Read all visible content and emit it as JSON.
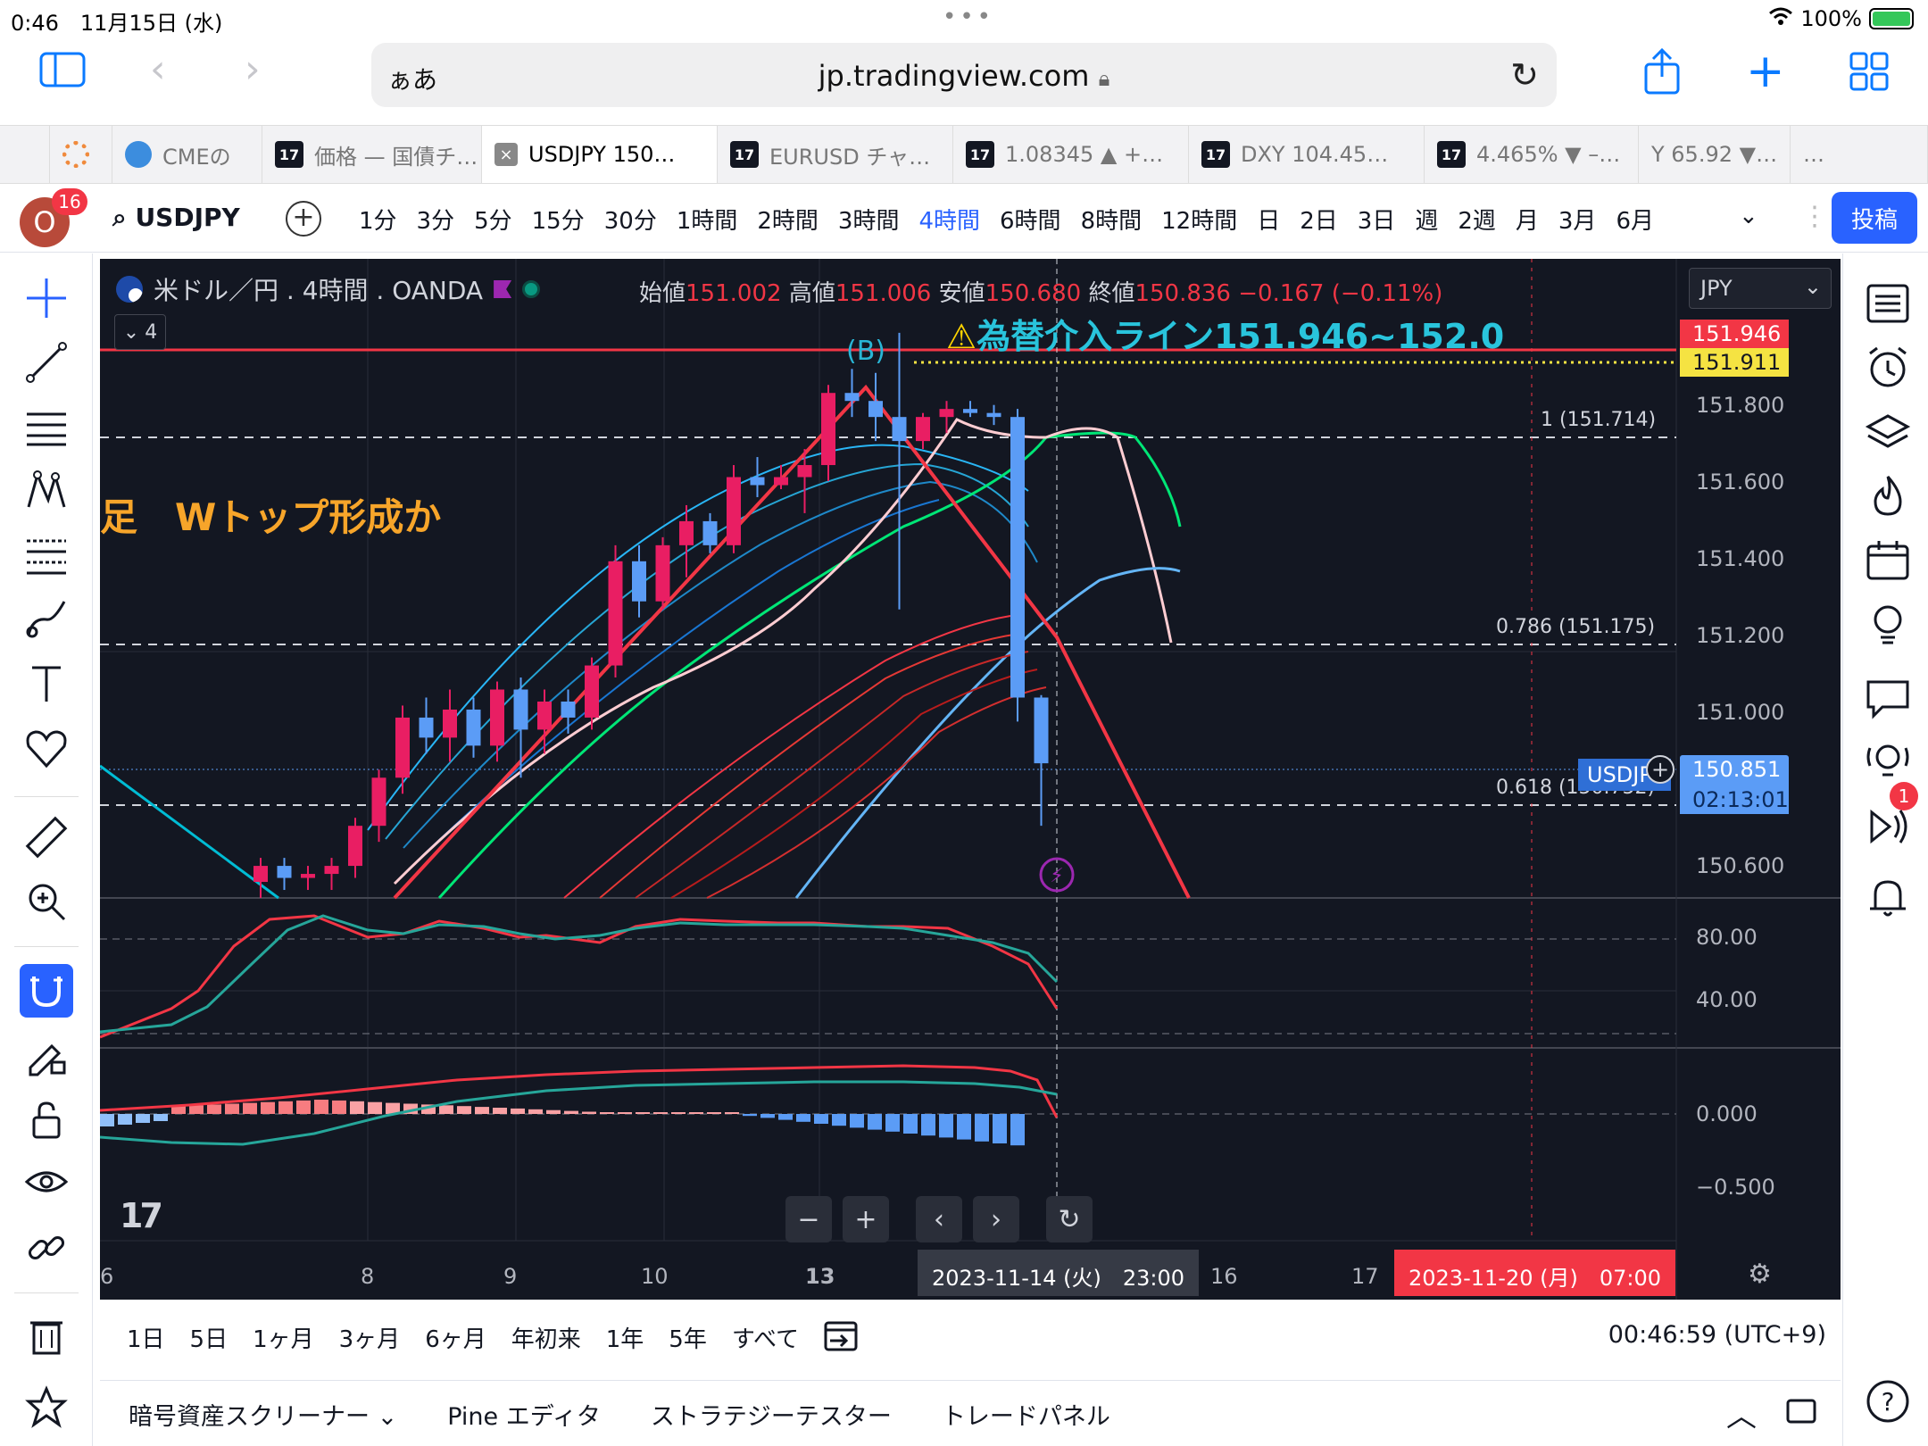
{
  "status_bar": {
    "time": "0:46",
    "date": "11月15日 (水)",
    "battery": "100%"
  },
  "safari": {
    "aa": "ぁあ",
    "url": "jp.tradingview.com"
  },
  "tabs": [
    {
      "label": "CMEの",
      "icon": "cme-icon"
    },
    {
      "label": "価格 — 国債チ…",
      "icon": "tv-icon"
    },
    {
      "label": "USDJPY 150…",
      "icon": "close-icon",
      "active": true
    },
    {
      "label": "EURUSD チャ…",
      "icon": "tv-icon"
    },
    {
      "label": "1.08345 ▲ +…",
      "icon": "tv-icon"
    },
    {
      "label": "DXY 104.45…",
      "icon": "tv-icon"
    },
    {
      "label": "4.465% ▼ –…",
      "icon": "tv-icon"
    },
    {
      "label": "Y 65.92 ▼…",
      "icon": ""
    },
    {
      "label": "…",
      "icon": ""
    }
  ],
  "toolbar": {
    "notification_count": "16",
    "symbol": "USDJPY",
    "intervals": [
      "1分",
      "3分",
      "5分",
      "15分",
      "30分",
      "1時間",
      "2時間",
      "3時間",
      "4時間",
      "6時間",
      "8時間",
      "12時間",
      "日",
      "2日",
      "3日",
      "週",
      "2週",
      "月",
      "3月",
      "6月"
    ],
    "active_interval": "4時間",
    "publish": "投稿"
  },
  "chart": {
    "title": "米ドル／円 . 4時間 . OANDA",
    "indicator_count": "4",
    "currency": "JPY",
    "ohlc": {
      "open_label": "始値",
      "open": "151.002",
      "high_label": "高値",
      "high": "151.006",
      "low_label": "安値",
      "low": "150.680",
      "close_label": "終値",
      "close": "150.836",
      "change": "−0.167 (−0.11%)"
    },
    "annotation_warning": "為替介入ライン151.946~152.0",
    "annotation_pattern": "足　Wトップ形成か",
    "annotation_b": "(B)",
    "fib_labels": {
      "f1": "1 (151.714)",
      "f786": "0.786 (151.175)",
      "f618": "0.618 (150.752)"
    },
    "price_labels": [
      "151.800",
      "151.600",
      "151.400",
      "151.200",
      "151.000",
      "150.600"
    ],
    "price_badge_red": "151.946",
    "price_badge_yellow": "151.911",
    "last_price": "150.851",
    "countdown": "02:13:01",
    "series_tag": "USDJPY",
    "osc_labels": [
      "80.00",
      "40.00"
    ],
    "macd_labels": [
      "0.000",
      "−0.500"
    ],
    "x_labels": [
      "6",
      "8",
      "9",
      "10",
      "13",
      "16",
      "17"
    ],
    "cursor_time": "2023-11-14 (火)　23:00",
    "future_time": "2023-11-20 (月)　07:00",
    "colors": {
      "up": "#e91e63",
      "down": "#5b9cf6",
      "line": "#f23645",
      "bg": "#131722"
    }
  },
  "chart_data": {
    "type": "candlestick",
    "symbol": "USDJPY 4H OANDA",
    "candles": [
      {
        "o": 150.54,
        "h": 150.6,
        "l": 150.5,
        "c": 150.58
      },
      {
        "o": 150.58,
        "h": 150.6,
        "l": 150.52,
        "c": 150.55
      },
      {
        "o": 150.55,
        "h": 150.58,
        "l": 150.52,
        "c": 150.56
      },
      {
        "o": 150.56,
        "h": 150.6,
        "l": 150.52,
        "c": 150.58
      },
      {
        "o": 150.58,
        "h": 150.7,
        "l": 150.55,
        "c": 150.68
      },
      {
        "o": 150.68,
        "h": 150.82,
        "l": 150.64,
        "c": 150.8
      },
      {
        "o": 150.8,
        "h": 150.98,
        "l": 150.76,
        "c": 150.95
      },
      {
        "o": 150.95,
        "h": 151.0,
        "l": 150.86,
        "c": 150.9
      },
      {
        "o": 150.9,
        "h": 151.02,
        "l": 150.84,
        "c": 150.97
      },
      {
        "o": 150.97,
        "h": 151.0,
        "l": 150.85,
        "c": 150.88
      },
      {
        "o": 150.88,
        "h": 151.04,
        "l": 150.84,
        "c": 151.02
      },
      {
        "o": 151.02,
        "h": 151.05,
        "l": 150.8,
        "c": 150.92
      },
      {
        "o": 150.92,
        "h": 151.02,
        "l": 150.86,
        "c": 150.99
      },
      {
        "o": 150.99,
        "h": 151.02,
        "l": 150.91,
        "c": 150.95
      },
      {
        "o": 150.95,
        "h": 151.1,
        "l": 150.92,
        "c": 151.08
      },
      {
        "o": 151.08,
        "h": 151.38,
        "l": 151.05,
        "c": 151.34
      },
      {
        "o": 151.34,
        "h": 151.38,
        "l": 151.2,
        "c": 151.24
      },
      {
        "o": 151.24,
        "h": 151.4,
        "l": 151.22,
        "c": 151.38
      },
      {
        "o": 151.38,
        "h": 151.48,
        "l": 151.3,
        "c": 151.44
      },
      {
        "o": 151.44,
        "h": 151.46,
        "l": 151.36,
        "c": 151.38
      },
      {
        "o": 151.38,
        "h": 151.58,
        "l": 151.36,
        "c": 151.55
      },
      {
        "o": 151.55,
        "h": 151.6,
        "l": 151.5,
        "c": 151.53
      },
      {
        "o": 151.53,
        "h": 151.58,
        "l": 151.52,
        "c": 151.55
      },
      {
        "o": 151.55,
        "h": 151.62,
        "l": 151.46,
        "c": 151.58
      },
      {
        "o": 151.58,
        "h": 151.78,
        "l": 151.54,
        "c": 151.76
      },
      {
        "o": 151.76,
        "h": 151.82,
        "l": 151.7,
        "c": 151.74
      },
      {
        "o": 151.74,
        "h": 151.81,
        "l": 151.64,
        "c": 151.7
      },
      {
        "o": 151.7,
        "h": 151.91,
        "l": 151.22,
        "c": 151.64
      },
      {
        "o": 151.64,
        "h": 151.71,
        "l": 151.62,
        "c": 151.7
      },
      {
        "o": 151.7,
        "h": 151.74,
        "l": 151.66,
        "c": 151.72
      },
      {
        "o": 151.72,
        "h": 151.74,
        "l": 151.7,
        "c": 151.71
      },
      {
        "o": 151.71,
        "h": 151.73,
        "l": 151.68,
        "c": 151.7
      },
      {
        "o": 151.7,
        "h": 151.72,
        "l": 150.94,
        "c": 151.0
      },
      {
        "o": 151.0,
        "h": 151.006,
        "l": 150.68,
        "c": 150.836
      }
    ],
    "horizontal_lines": [
      151.946,
      151.911,
      151.714,
      151.175,
      150.752
    ],
    "y_ticks": [
      151.8,
      151.6,
      151.4,
      151.2,
      151.0,
      150.6
    ],
    "ylim": [
      150.5,
      152.05
    ],
    "oscillator_ticks": [
      80,
      40
    ],
    "macd_ticks": [
      0.0,
      -0.5
    ]
  },
  "range_bar": {
    "ranges": [
      "1日",
      "5日",
      "1ヶ月",
      "3ヶ月",
      "6ヶ月",
      "年初来",
      "1年",
      "5年",
      "すべて"
    ],
    "clock": "00:46:59 (UTC+9)"
  },
  "bottom_tabs": [
    "暗号資産スクリーナー",
    "Pine エディタ",
    "ストラテジーテスター",
    "トレードパネル"
  ],
  "right_badge": "1"
}
